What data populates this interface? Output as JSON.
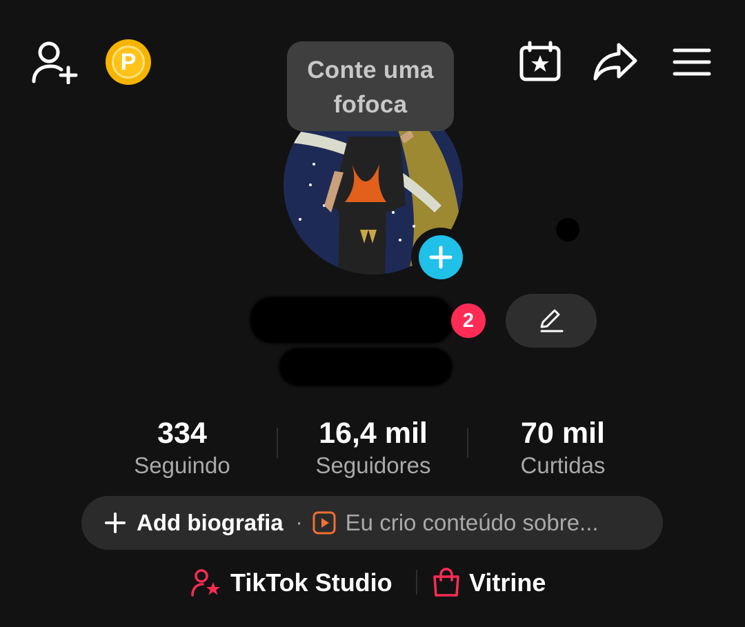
{
  "tooltip": {
    "line1": "Conte uma",
    "line2": "fofoca"
  },
  "header": {
    "coin_letter": "P"
  },
  "notification_badge": "2",
  "stats": [
    {
      "value": "334",
      "label": "Seguindo"
    },
    {
      "value": "16,4 mil",
      "label": "Seguidores"
    },
    {
      "value": "70 mil",
      "label": "Curtidas"
    }
  ],
  "bio": {
    "add_label": "Add biografia",
    "separator": "·",
    "hint": "Eu crio conteúdo sobre..."
  },
  "links": {
    "studio_label": "TikTok Studio",
    "showcase_label": "Vitrine"
  },
  "colors": {
    "background": "#121212",
    "accent_red": "#fe2c55",
    "accent_cyan": "#20c0e8",
    "coin": "#f5b400",
    "muted_text": "#a9a9a9",
    "pill": "#2b2b2b"
  },
  "icons": [
    "add-friend-icon",
    "coin-icon",
    "calendar-star-icon",
    "share-icon",
    "menu-icon",
    "plus-icon",
    "edit-pencil-icon",
    "play-icon",
    "studio-icon",
    "shopping-bag-icon"
  ]
}
